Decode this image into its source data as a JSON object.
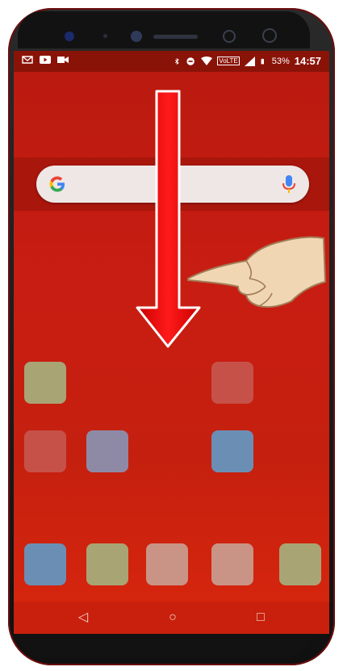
{
  "status_bar": {
    "battery_percent": "53%",
    "time": "14:57",
    "network_label": "VoLTE",
    "left_icons": [
      "gmail-icon",
      "youtube-icon",
      "video-call-icon"
    ],
    "right_icons": [
      "bluetooth-icon",
      "do-not-disturb-icon",
      "wifi-icon",
      "volte-icon",
      "signal-icon",
      "battery-icon"
    ]
  },
  "search_bar": {
    "logo": "google-logo-icon",
    "mic": "mic-icon"
  },
  "overlay": {
    "arrow": "swipe-down-arrow-icon",
    "hand": "pointing-hand-icon"
  },
  "home_grid": {
    "row1": [
      "#a9a474",
      "#c65149"
    ],
    "row2": [
      "#c65149",
      "#8e8aa6",
      "#6b8fb4"
    ],
    "dock": [
      "#6b8fb4",
      "#a9a474",
      "#c99486",
      "#c99486",
      "#a9a474"
    ]
  },
  "nav_bar": {
    "back": "◁",
    "home": "○",
    "recents": "□"
  },
  "colors": {
    "wallpaper": "#c41d11",
    "status_bar": "#8a1308"
  }
}
